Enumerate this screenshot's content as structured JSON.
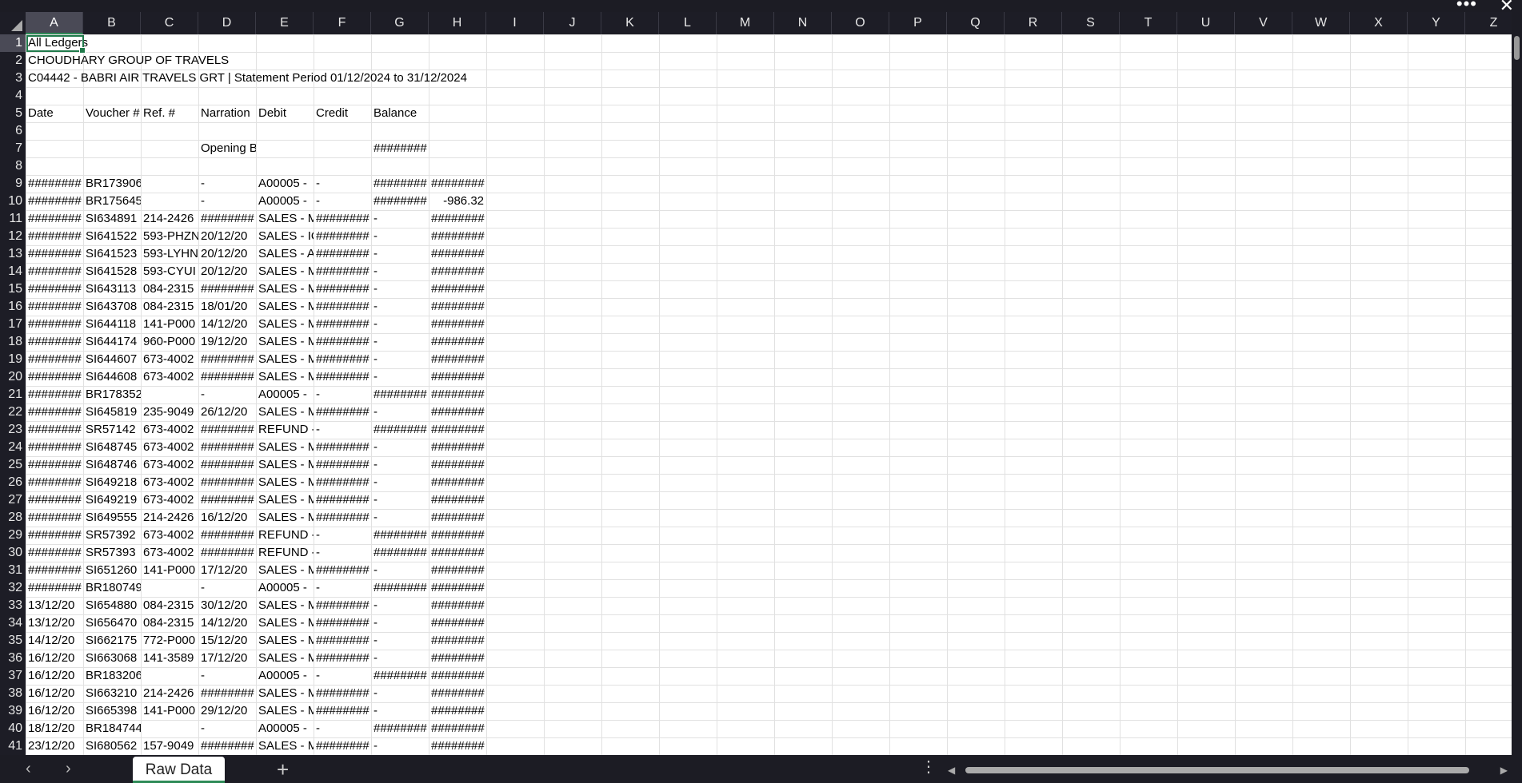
{
  "columns": [
    "A",
    "B",
    "C",
    "D",
    "E",
    "F",
    "G",
    "H",
    "I",
    "J",
    "K",
    "L",
    "M",
    "N",
    "O",
    "P",
    "Q",
    "R",
    "S",
    "T",
    "U",
    "V",
    "W",
    "X",
    "Y",
    "Z"
  ],
  "header_rows": {
    "r1": "All Ledgers",
    "r2": "CHOUDHARY GROUP OF TRAVELS",
    "r3": "C04442 - BABRI AIR TRAVELS GRT | Statement Period 01/12/2024 to 31/12/2024"
  },
  "column_headers": [
    "Date",
    "Voucher #",
    "Ref. #",
    "Narration",
    "Debit",
    "Credit",
    "Balance",
    ""
  ],
  "opening_row": [
    "",
    "",
    "",
    "Opening B",
    "",
    "",
    "########",
    ""
  ],
  "rows": [
    [
      "########",
      "BR173906",
      "",
      "-",
      "A00005 -",
      "-",
      "########",
      "########"
    ],
    [
      "########",
      "BR175645",
      "",
      "-",
      "A00005 -",
      "-",
      "########",
      "-986.32"
    ],
    [
      "########",
      "SI634891",
      "214-2426",
      "########",
      "SALES - M",
      "########",
      "-",
      "########"
    ],
    [
      "########",
      "SI641522",
      "593-PHZN",
      "20/12/20",
      "SALES - IQ",
      "########",
      "-",
      "########"
    ],
    [
      "########",
      "SI641523",
      "593-LYHN",
      "20/12/20",
      "SALES - AI",
      "########",
      "-",
      "########"
    ],
    [
      "########",
      "SI641528",
      "593-CYUI",
      "20/12/20",
      "SALES - M",
      "########",
      "-",
      "########"
    ],
    [
      "########",
      "SI643113",
      "084-2315",
      "########",
      "SALES - M",
      "########",
      "-",
      "########"
    ],
    [
      "########",
      "SI643708",
      "084-2315",
      "18/01/20",
      "SALES - M",
      "########",
      "-",
      "########"
    ],
    [
      "########",
      "SI644118",
      "141-P000",
      "14/12/20",
      "SALES - M",
      "########",
      "-",
      "########"
    ],
    [
      "########",
      "SI644174",
      "960-P000",
      "19/12/20",
      "SALES - M",
      "########",
      "-",
      "########"
    ],
    [
      "########",
      "SI644607",
      "673-4002",
      "########",
      "SALES - M",
      "########",
      "-",
      "########"
    ],
    [
      "########",
      "SI644608",
      "673-4002",
      "########",
      "SALES - M",
      "########",
      "-",
      "########"
    ],
    [
      "########",
      "BR178352",
      "",
      "-",
      "A00005 -",
      "-",
      "########",
      "########"
    ],
    [
      "########",
      "SI645819",
      "235-9049",
      "26/12/20",
      "SALES - M",
      "########",
      "-",
      "########"
    ],
    [
      "########",
      "SR57142",
      "673-4002",
      "########",
      "REFUND -",
      "-",
      "########",
      "########"
    ],
    [
      "########",
      "SI648745",
      "673-4002",
      "########",
      "SALES - M",
      "########",
      "-",
      "########"
    ],
    [
      "########",
      "SI648746",
      "673-4002",
      "########",
      "SALES - M",
      "########",
      "-",
      "########"
    ],
    [
      "########",
      "SI649218",
      "673-4002",
      "########",
      "SALES - M",
      "########",
      "-",
      "########"
    ],
    [
      "########",
      "SI649219",
      "673-4002",
      "########",
      "SALES - M",
      "########",
      "-",
      "########"
    ],
    [
      "########",
      "SI649555",
      "214-2426",
      "16/12/20",
      "SALES - M",
      "########",
      "-",
      "########"
    ],
    [
      "########",
      "SR57392",
      "673-4002",
      "########",
      "REFUND -",
      "-",
      "########",
      "########"
    ],
    [
      "########",
      "SR57393",
      "673-4002",
      "########",
      "REFUND -",
      "-",
      "########",
      "########"
    ],
    [
      "########",
      "SI651260",
      "141-P000",
      "17/12/20",
      "SALES - M",
      "########",
      "-",
      "########"
    ],
    [
      "########",
      "BR180749",
      "",
      "-",
      "A00005 -",
      "-",
      "########",
      "########"
    ],
    [
      "13/12/20",
      "SI654880",
      "084-2315",
      "30/12/20",
      "SALES - M",
      "########",
      "-",
      "########"
    ],
    [
      "13/12/20",
      "SI656470",
      "084-2315",
      "14/12/20",
      "SALES - M",
      "########",
      "-",
      "########"
    ],
    [
      "14/12/20",
      "SI662175",
      "772-P000",
      "15/12/20",
      "SALES - M",
      "########",
      "-",
      "########"
    ],
    [
      "16/12/20",
      "SI663068",
      "141-3589",
      "17/12/20",
      "SALES - M",
      "########",
      "-",
      "########"
    ],
    [
      "16/12/20",
      "BR183206",
      "",
      "-",
      "A00005 -",
      "-",
      "########",
      "########"
    ],
    [
      "16/12/20",
      "SI663210",
      "214-2426",
      "########",
      "SALES - M",
      "########",
      "-",
      "########"
    ],
    [
      "16/12/20",
      "SI665398",
      "141-P000",
      "29/12/20",
      "SALES - M",
      "########",
      "-",
      "########"
    ],
    [
      "18/12/20",
      "BR184744",
      "",
      "-",
      "A00005 -",
      "-",
      "########",
      "########"
    ],
    [
      "23/12/20",
      "SI680562",
      "157-9049",
      "########",
      "SALES - M",
      "########",
      "-",
      "########"
    ]
  ],
  "sheet_tab": "Raw Data",
  "icons": {
    "more": "more-horizontal-icon",
    "close": "close-icon",
    "prev": "chevron-left-icon",
    "next": "chevron-right-icon",
    "add": "plus-icon"
  }
}
